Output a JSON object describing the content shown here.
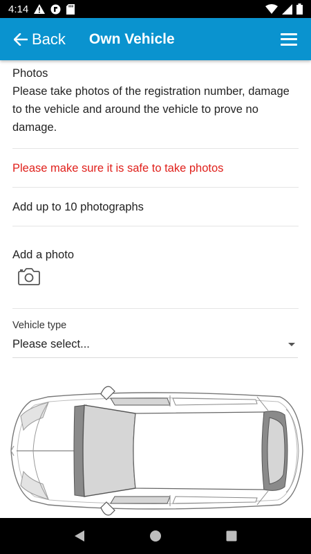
{
  "status_bar": {
    "time": "4:14",
    "icons_left": [
      "alert-icon",
      "app-badge-icon",
      "sd-card-icon"
    ],
    "icons_right": [
      "wifi-icon",
      "signal-icon",
      "battery-icon"
    ]
  },
  "app_bar": {
    "back_label": "Back",
    "title": "Own Vehicle",
    "color": "#0a93cf"
  },
  "photos": {
    "heading": "Photos",
    "description": "Please take photos of the registration number, damage to the vehicle and around the vehicle to prove no damage."
  },
  "warning": {
    "text": "Please make sure it is safe to take photos",
    "color": "#e0201b"
  },
  "limit_text": "Add up to 10 photographs",
  "add_photo": {
    "label": "Add a photo",
    "icon": "camera-icon"
  },
  "vehicle_type": {
    "label": "Vehicle type",
    "selected": "Please select..."
  },
  "diagram": {
    "type": "car-top-view"
  },
  "nav_bar": {
    "buttons": [
      "back-triangle-icon",
      "home-circle-icon",
      "recents-square-icon"
    ]
  }
}
